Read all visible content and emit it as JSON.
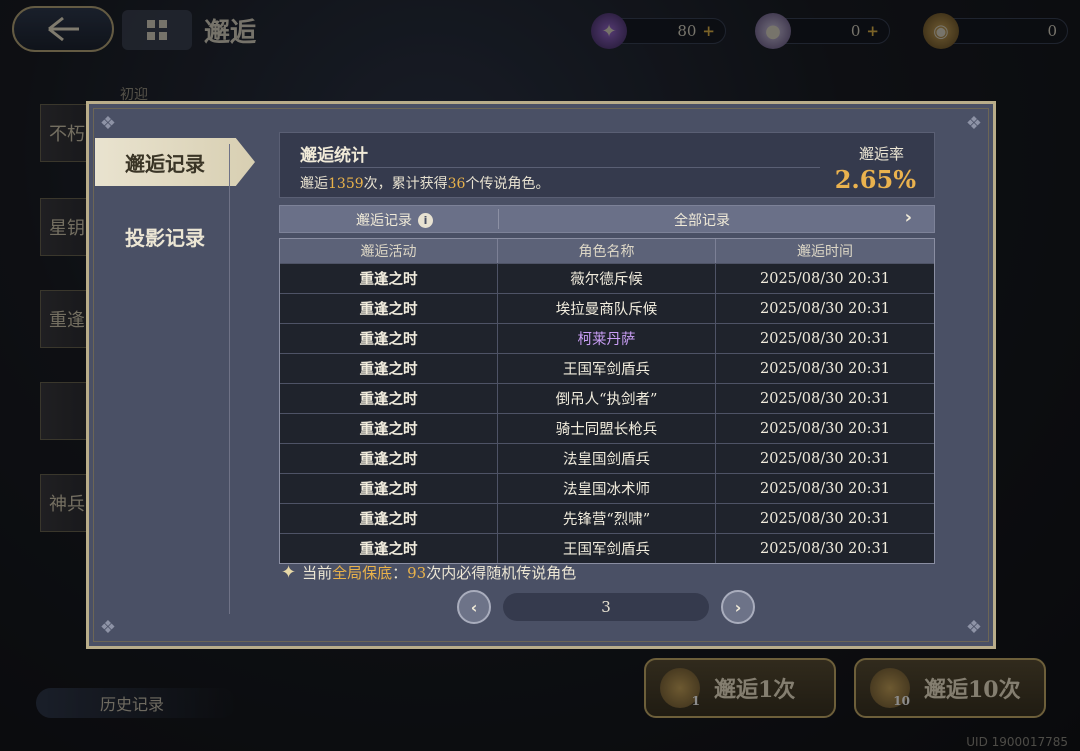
{
  "topbar": {
    "title": "邂逅",
    "resources": [
      {
        "icon": "star-crystal-icon",
        "value": "80"
      },
      {
        "icon": "feather-orb-icon",
        "value": "0"
      },
      {
        "icon": "gold-coin-icon",
        "value": "0"
      }
    ]
  },
  "background": {
    "banners": [
      "不朽",
      "星钥",
      "重逢",
      "",
      "神兵"
    ],
    "banner_group_label": "初迎",
    "history_tab": "历史记录",
    "draw_once": "邂逅1次",
    "draw_once_count": "1",
    "draw_ten": "邂逅10次",
    "draw_ten_count": "10",
    "uid": "UID 1900017785"
  },
  "modal": {
    "tabs": [
      "邂逅记录",
      "投影记录"
    ],
    "active_tab": 0,
    "stats": {
      "title": "邂逅统计",
      "desc_prefix": "邂逅",
      "draw_count": "1359",
      "desc_middle": "次，累计获得",
      "legend_count": "36",
      "desc_suffix": "个传说角色。",
      "rate_label": "邂逅率",
      "rate_value": "2.65%"
    },
    "filter": {
      "label": "邂逅记录",
      "value": "全部记录"
    },
    "table": {
      "headers": [
        "邂逅活动",
        "角色名称",
        "邂逅时间"
      ],
      "rows": [
        {
          "activity": "重逢之时",
          "name": "薇尔德斥候",
          "time": "2025/08/30 20:31",
          "rarity": "normal"
        },
        {
          "activity": "重逢之时",
          "name": "埃拉曼商队斥候",
          "time": "2025/08/30 20:31",
          "rarity": "normal"
        },
        {
          "activity": "重逢之时",
          "name": "柯莱丹萨",
          "time": "2025/08/30 20:31",
          "rarity": "epic"
        },
        {
          "activity": "重逢之时",
          "name": "王国军剑盾兵",
          "time": "2025/08/30 20:31",
          "rarity": "normal"
        },
        {
          "activity": "重逢之时",
          "name": "倒吊人“执剑者”",
          "time": "2025/08/30 20:31",
          "rarity": "normal"
        },
        {
          "activity": "重逢之时",
          "name": "骑士同盟长枪兵",
          "time": "2025/08/30 20:31",
          "rarity": "normal"
        },
        {
          "activity": "重逢之时",
          "name": "法皇国剑盾兵",
          "time": "2025/08/30 20:31",
          "rarity": "normal"
        },
        {
          "activity": "重逢之时",
          "name": "法皇国冰术师",
          "time": "2025/08/30 20:31",
          "rarity": "normal"
        },
        {
          "activity": "重逢之时",
          "name": "先锋营“烈啸”",
          "time": "2025/08/30 20:31",
          "rarity": "normal"
        },
        {
          "activity": "重逢之时",
          "name": "王国军剑盾兵",
          "time": "2025/08/30 20:31",
          "rarity": "normal"
        }
      ]
    },
    "pity": {
      "prefix": "当前",
      "highlight": "全局保底",
      "colon": "：",
      "count": "93",
      "suffix": "次内必得随机传说角色"
    },
    "pager": {
      "page": "3"
    }
  },
  "colors": {
    "accent_gold": "#e9b24a",
    "epic_purple": "#c99ef5",
    "panel": "#4a5065"
  }
}
